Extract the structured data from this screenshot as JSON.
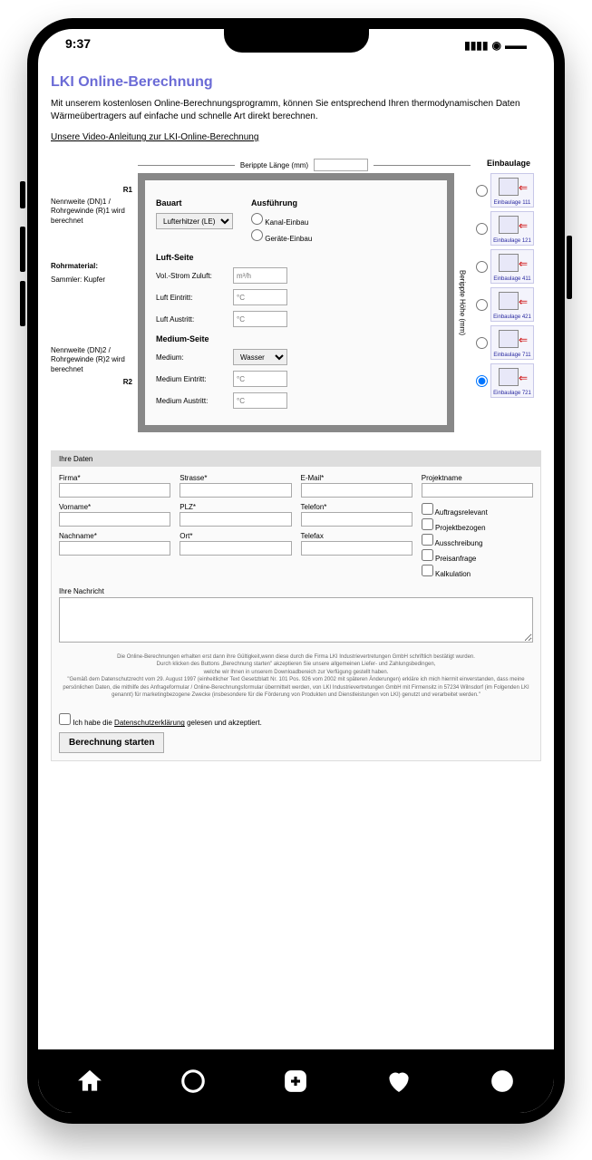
{
  "status": {
    "time": "9:37"
  },
  "page": {
    "title": "LKI Online-Berechnung",
    "intro": "Mit unserem kostenlosen Online-Berechnungsprogramm, können Sie entsprechend Ihren thermodynamischen Daten Wärmeübertragers auf einfache und schnelle Art direkt berechnen.",
    "video_link": "Unsere Video-Anleitung zur LKI-Online-Berechnung"
  },
  "leftLabels": {
    "r1": "R1",
    "nw1": "Nennweite (DN)1 / Rohrgewinde (R)1 wird berechnet",
    "rohrmaterial_h": "Rohrmaterial:",
    "rohrmaterial_v": "Sammler: Kupfer",
    "nw2": "Nennweite (DN)2 / Rohrgewinde (R)2 wird berechnet",
    "r2": "R2"
  },
  "dims": {
    "length_label": "Berippte Länge (mm)",
    "height_label": "Berippte Höhe (mm)"
  },
  "form": {
    "bauart_h": "Bauart",
    "bauart_options": [
      "Lufterhitzer (LE)"
    ],
    "ausfuehrung_h": "Ausführung",
    "ausf_opt1": "Kanal-Einbau",
    "ausf_opt2": "Geräte-Einbau",
    "luft_h": "Luft-Seite",
    "vol_label": "Vol.-Strom Zuluft:",
    "vol_unit": "m³/h",
    "luft_ein_label": "Luft Eintritt:",
    "luft_aus_label": "Luft Austritt:",
    "temp_unit": "°C",
    "medium_h": "Medium-Seite",
    "medium_label": "Medium:",
    "medium_options": [
      "Wasser"
    ],
    "medium_ein_label": "Medium Eintritt:",
    "medium_aus_label": "Medium Austritt:"
  },
  "einbau": {
    "title": "Einbaulage",
    "opts": [
      {
        "label": "Einbaulage 111"
      },
      {
        "label": "Einbaulage 121"
      },
      {
        "label": "Einbaulage 411"
      },
      {
        "label": "Einbaulage 421"
      },
      {
        "label": "Einbaulage 711"
      },
      {
        "label": "Einbaulage 721"
      }
    ],
    "selected": 5
  },
  "userData": {
    "header": "Ihre Daten",
    "fields": {
      "firma": "Firma*",
      "strasse": "Strasse*",
      "email": "E-Mail*",
      "projekt": "Projektname",
      "vorname": "Vorname*",
      "plz": "PLZ*",
      "telefon": "Telefon*",
      "nachname": "Nachname*",
      "ort": "Ort*",
      "telefax": "Telefax"
    },
    "checks": {
      "c1": "Auftragsrelevant",
      "c2": "Projektbezogen",
      "c3": "Ausschreibung",
      "c4": "Preisanfrage",
      "c5": "Kalkulation"
    },
    "msg_label": "Ihre Nachricht"
  },
  "legal": {
    "line1": "Die Online-Berechnungen erhalten erst dann ihre Gültigkeit,wenn diese durch die Firma LKI Industrievertretungen GmbH schriftlich bestätigt wurden.",
    "line2": "Durch klicken des Buttons „Berechnung starten\" akzeptieren Sie unsere allgemeinen Liefer- und Zahlungsbedingen,",
    "line3": "welche wir Ihnen in unserem Downloadbereich zur Verfügung gestellt haben.",
    "line4": "\"Gemäß dem Datenschutzrecht vom 29. August 1997 (einheitlicher Text Gesetzblatt Nr. 101 Pos. 926 vom 2002 mit späteren Änderungen) erkläre ich mich hiermit einverstanden, dass meine persönlichen Daten, die mithilfe des Anfrageformular / Online-Berechnungsformular übermittelt werden, von LKI Industrievertretungen GmbH mit Firmensitz in 57234 Wilnsdorf (im Folgenden LKI genannt) für marketingbezogene Zwecke (insbesondere für die Förderung von Produkten und Dienstleistungen von LKI) genutzt und verarbeitet werden.\""
  },
  "privacy": {
    "pre": "Ich habe die ",
    "link": "Datenschutzerklärung",
    "post": " gelesen und akzeptiert."
  },
  "submit": "Berechnung starten"
}
